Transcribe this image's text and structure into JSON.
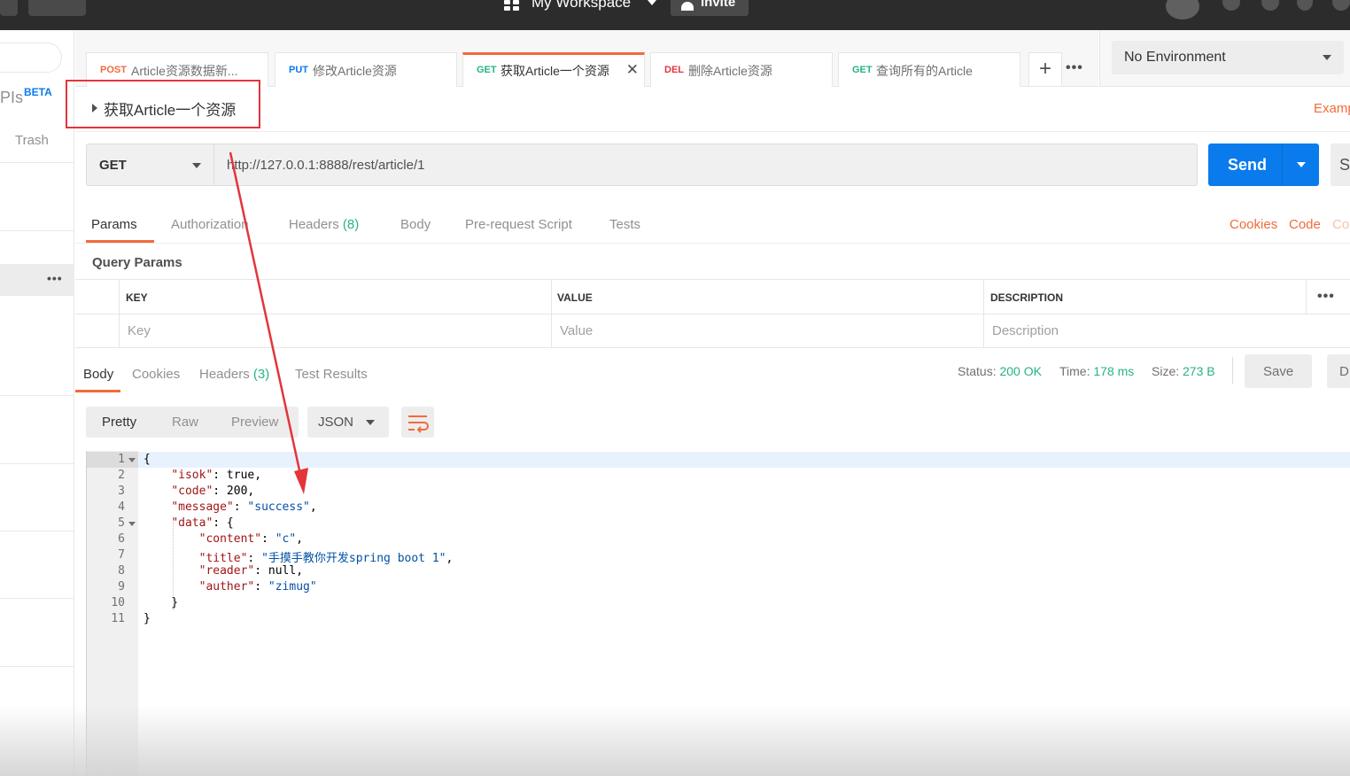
{
  "topbar": {
    "workspace_label": "My Workspace",
    "invite_label": "Invite"
  },
  "sidebar": {
    "apis_label": "PIs",
    "beta_label": "BETA",
    "trash_label": "Trash"
  },
  "tabs": [
    {
      "method": "POST",
      "method_color": "#f26b3a",
      "name": "Article资源数据新..."
    },
    {
      "method": "PUT",
      "method_color": "#097bed",
      "name": "修改Article资源"
    },
    {
      "method": "GET",
      "method_color": "#26b47f",
      "name": "获取Article一个资源"
    },
    {
      "method": "DEL",
      "method_color": "#e3353a",
      "name": "删除Article资源"
    },
    {
      "method": "GET",
      "method_color": "#26b47f",
      "name": "查询所有的Article"
    }
  ],
  "environment": {
    "selected": "No Environment"
  },
  "request": {
    "name": "获取Article一个资源",
    "examples_label": "Examp",
    "method": "GET",
    "url": "http://127.0.0.1:8888/rest/article/1",
    "send_label": "Send",
    "save_label": "Sa"
  },
  "request_tabs": {
    "params": "Params",
    "authorization": "Authorization",
    "headers": "Headers",
    "headers_count": "(8)",
    "body": "Body",
    "prerequest": "Pre-request Script",
    "tests": "Tests",
    "cookies": "Cookies",
    "code": "Code",
    "comments": "Co"
  },
  "query_params": {
    "title": "Query Params",
    "columns": [
      "KEY",
      "VALUE",
      "DESCRIPTION"
    ],
    "placeholders": [
      "Key",
      "Value",
      "Description"
    ]
  },
  "response": {
    "tabs": {
      "body": "Body",
      "cookies": "Cookies",
      "headers": "Headers",
      "headers_count": "(3)",
      "tests": "Test Results"
    },
    "status_label": "Status:",
    "status_value": "200 OK",
    "time_label": "Time:",
    "time_value": "178 ms",
    "size_label": "Size:",
    "size_value": "273 B",
    "save_label": "Save",
    "download_label": "D",
    "view_modes": [
      "Pretty",
      "Raw",
      "Preview"
    ],
    "format": "JSON",
    "body_lines": [
      "{",
      "    \"isok\": true,",
      "    \"code\": 200,",
      "    \"message\": \"success\",",
      "    \"data\": {",
      "        \"content\": \"c\",",
      "        \"title\": \"手摸手教你开发spring boot 1\",",
      "        \"reader\": null,",
      "        \"auther\": \"zimug\"",
      "    }",
      "}"
    ]
  },
  "colors": {
    "accent": "#f26b3a",
    "primary": "#097bed",
    "success": "#26b47f",
    "annotation": "#e3353a"
  }
}
